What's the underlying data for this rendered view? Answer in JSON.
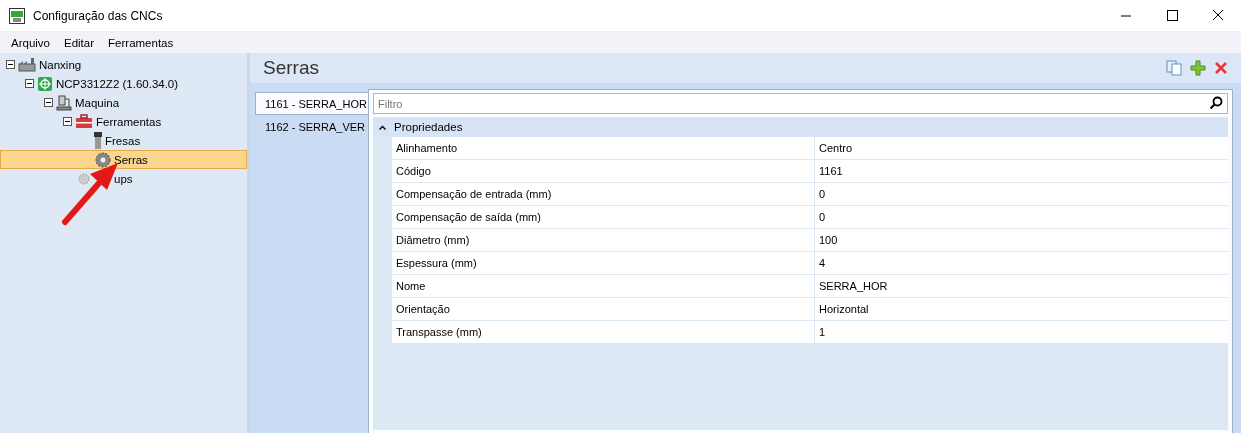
{
  "window": {
    "title": "Configuração das CNCs"
  },
  "menu": [
    "Arquivo",
    "Editar",
    "Ferramentas"
  ],
  "tree": [
    {
      "label": "Nanxing",
      "kind": "factory",
      "expanded": true,
      "selected": false,
      "children": [
        {
          "label": "NCP3312Z2 (1.60.34.0)",
          "kind": "board",
          "expanded": true,
          "selected": false,
          "children": [
            {
              "label": "Maquina",
              "kind": "machine",
              "expanded": true,
              "selected": false,
              "children": [
                {
                  "label": "Ferramentas",
                  "kind": "toolbox",
                  "expanded": true,
                  "selected": false,
                  "children": [
                    {
                      "label": "Fresas",
                      "kind": "mill",
                      "selected": false
                    },
                    {
                      "label": "Serras",
                      "kind": "saw",
                      "selected": true
                    }
                  ]
                },
                {
                  "label": "ups",
                  "kind": "gear",
                  "selected": false
                }
              ]
            }
          ]
        }
      ]
    }
  ],
  "panel": {
    "title": "Serras"
  },
  "tabs": [
    {
      "label": "1161 - SERRA_HOR",
      "selected": true
    },
    {
      "label": "1162 - SERRA_VER",
      "selected": false
    }
  ],
  "filter": {
    "placeholder": "Filtro"
  },
  "category": {
    "label": "Propriedades",
    "expanded": true
  },
  "properties": [
    {
      "name": "Alinhamento",
      "value": "Centro"
    },
    {
      "name": "Código",
      "value": "1161"
    },
    {
      "name": "Compensação de entrada (mm)",
      "value": "0"
    },
    {
      "name": "Compensação de saída (mm)",
      "value": "0"
    },
    {
      "name": "Diâmetro (mm)",
      "value": "100"
    },
    {
      "name": "Espessura (mm)",
      "value": "4"
    },
    {
      "name": "Nome",
      "value": "SERRA_HOR"
    },
    {
      "name": "Orientação",
      "value": "Horizontal"
    },
    {
      "name": "Transpasse (mm)",
      "value": "1"
    }
  ]
}
